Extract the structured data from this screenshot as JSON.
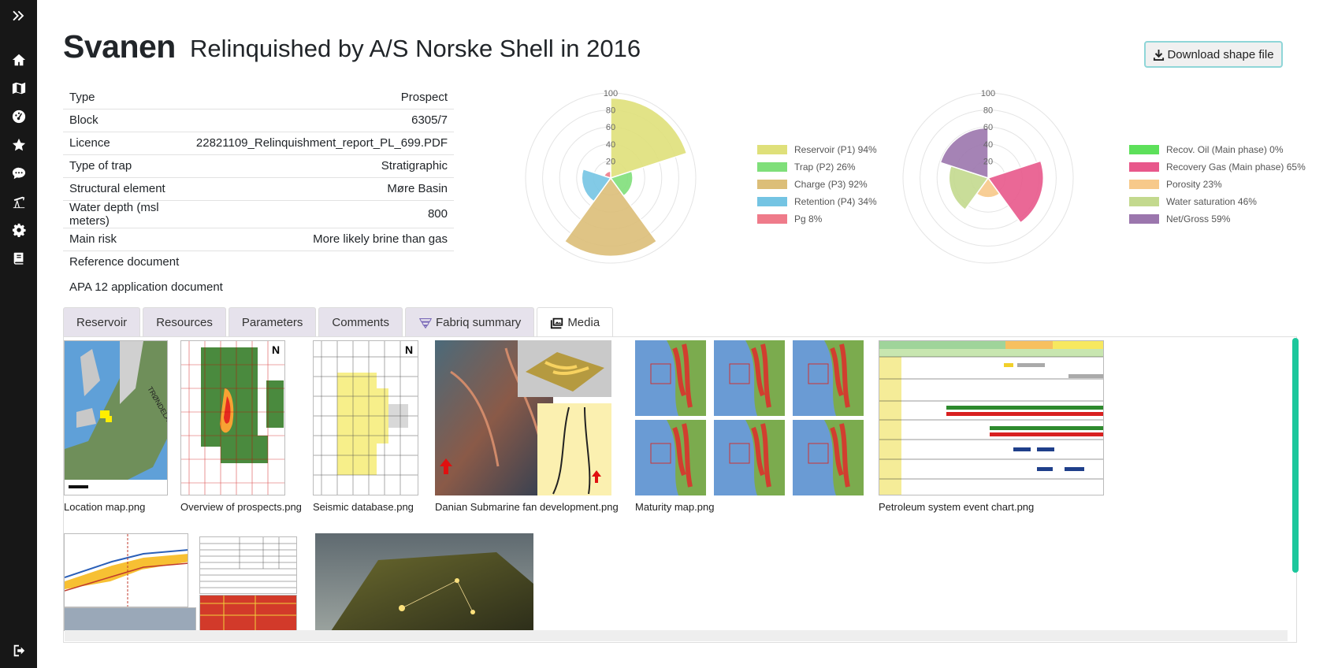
{
  "header": {
    "title": "Svanen",
    "subtitle": "Relinquished by A/S Norske Shell in 2016",
    "download_label": "Download shape file"
  },
  "properties": [
    {
      "label": "Type",
      "value": "Prospect"
    },
    {
      "label": "Block",
      "value": "6305/7"
    },
    {
      "label": "Licence",
      "value": "22821109_Relinquishment_report_PL_699.PDF"
    },
    {
      "label": "Type of trap",
      "value": "Stratigraphic"
    },
    {
      "label": "Structural element",
      "value": "Møre Basin"
    },
    {
      "label": "Water depth (msl meters)",
      "value": "800"
    },
    {
      "label": "Main risk",
      "value": "More likely brine than gas"
    },
    {
      "label": "Reference document",
      "value": ""
    }
  ],
  "reference_document": "APA 12 application document",
  "chart_data": [
    {
      "type": "polar-area",
      "rlim": [
        0,
        100
      ],
      "ticks": [
        "100",
        "80",
        "60",
        "40",
        "20"
      ],
      "series": [
        {
          "name": "Reservoir (P1) 94%",
          "value": 94,
          "color": "#dfe07a"
        },
        {
          "name": "Trap (P2) 26%",
          "value": 26,
          "color": "#7fdf7a"
        },
        {
          "name": "Charge (P3) 92%",
          "value": 92,
          "color": "#dcbe78"
        },
        {
          "name": "Retention (P4) 34%",
          "value": 34,
          "color": "#74c4e3"
        },
        {
          "name": "Pg 8%",
          "value": 8,
          "color": "#ef7b8a"
        }
      ]
    },
    {
      "type": "polar-area",
      "rlim": [
        0,
        100
      ],
      "ticks": [
        "100",
        "80",
        "60",
        "40",
        "20"
      ],
      "series": [
        {
          "name": "Recov. Oil (Main phase) 0%",
          "value": 0,
          "color": "#5de05a"
        },
        {
          "name": "Recovery Gas (Main phase) 65%",
          "value": 65,
          "color": "#e8588b"
        },
        {
          "name": "Porosity 23%",
          "value": 23,
          "color": "#f7c98a"
        },
        {
          "name": "Water saturation 46%",
          "value": 46,
          "color": "#c3d98e"
        },
        {
          "name": "Net/Gross 59%",
          "value": 59,
          "color": "#9b76ad"
        }
      ]
    }
  ],
  "tabs": [
    {
      "label": "Reservoir"
    },
    {
      "label": "Resources"
    },
    {
      "label": "Parameters"
    },
    {
      "label": "Comments"
    },
    {
      "label": "Fabriq summary"
    },
    {
      "label": "Media"
    }
  ],
  "media": [
    {
      "caption": "Location map.png"
    },
    {
      "caption": "Overview of prospects.png"
    },
    {
      "caption": "Seismic database.png"
    },
    {
      "caption": "Danian Submarine fan development.png"
    },
    {
      "caption": "Maturity map.png"
    },
    {
      "caption": "Petroleum system event chart.png"
    }
  ]
}
